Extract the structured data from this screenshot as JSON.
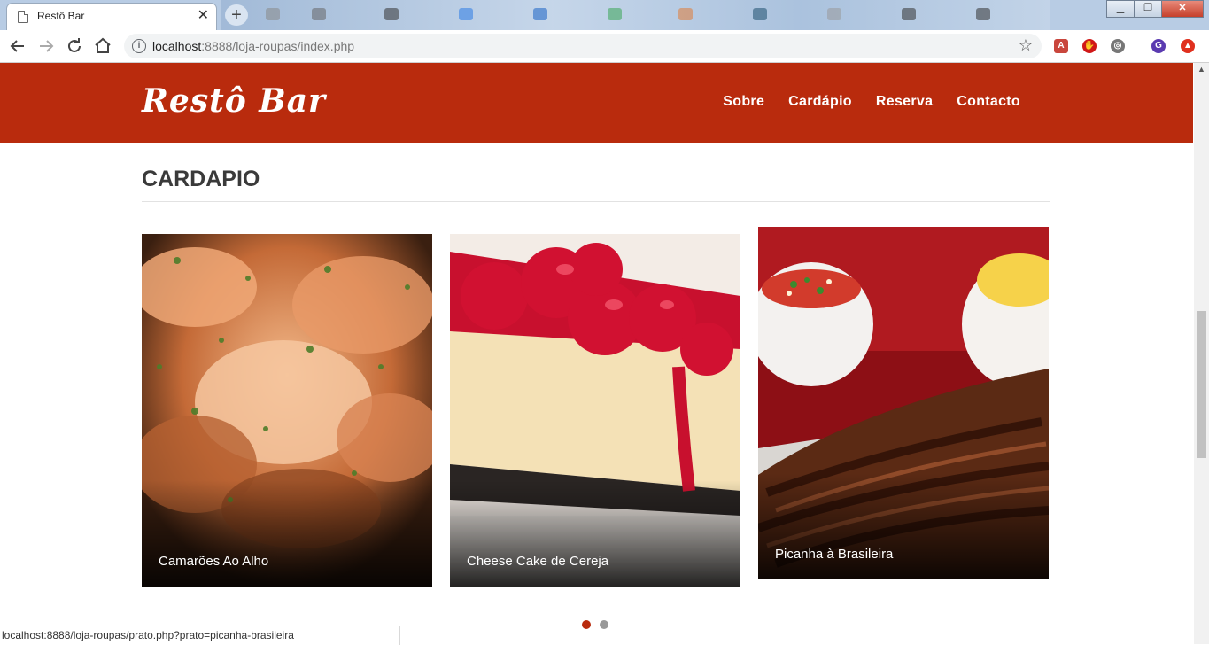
{
  "browser": {
    "tab_title": "Restô Bar",
    "tab_close": "✕",
    "new_tab": "+",
    "url_host": "localhost",
    "url_rest": ":8888/loja-roupas/index.php",
    "window_controls": {
      "minimize": "▁",
      "maximize": "❐",
      "close": "✕"
    },
    "toolbar_icons": [
      "back-arrow-icon",
      "forward-arrow-icon",
      "reload-icon",
      "home-icon",
      "site-info-icon",
      "star-icon"
    ],
    "extensions": [
      {
        "name": "pdf-extension-icon",
        "color": "#c9463d",
        "glyph": "A"
      },
      {
        "name": "adblock-icon",
        "color": "#d01818",
        "glyph": "✋"
      },
      {
        "name": "dev-tools-extension-icon",
        "color": "#777777",
        "glyph": "◎"
      },
      {
        "name": "profile-avatar-icon",
        "color": "#5a3ab0",
        "glyph": "G"
      },
      {
        "name": "upload-extension-icon",
        "color": "#e0301e",
        "glyph": "▲"
      }
    ]
  },
  "page": {
    "brand": "Restô Bar",
    "nav": [
      "Sobre",
      "Cardápio",
      "Reserva",
      "Contacto"
    ],
    "section_title": "CARDAPIO",
    "cards": [
      {
        "label": "Camarões Ao Alho",
        "image": "shrimp-garlic-photo"
      },
      {
        "label": "Cheese Cake de Cereja",
        "image": "cherry-cheesecake-photo"
      },
      {
        "label": "Picanha à Brasileira",
        "image": "picanha-steak-photo"
      }
    ],
    "carousel_pages": 2,
    "carousel_active": 1
  },
  "status_url": "localhost:8888/loja-roupas/prato.php?prato=picanha-brasileira",
  "colors": {
    "brand_red": "#b92b0d",
    "text_dark": "#3a3a3a"
  }
}
